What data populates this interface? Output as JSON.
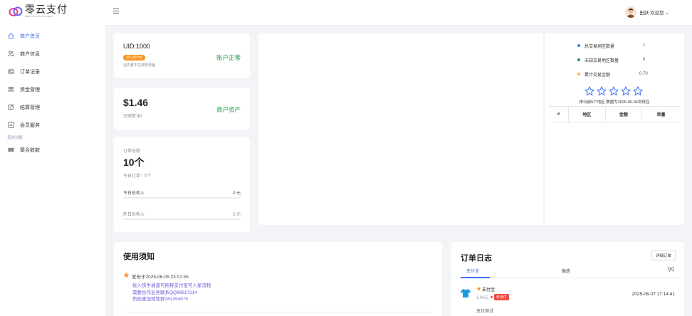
{
  "brand": {
    "title": "零云支付",
    "subtitle": "ZERO CLOUD PAYMENT"
  },
  "sidebar": {
    "items": [
      {
        "label": "商户首页",
        "icon": "home-icon",
        "active": true
      },
      {
        "label": "商户信息",
        "icon": "users-icon"
      },
      {
        "label": "订单记录",
        "icon": "order-icon"
      },
      {
        "label": "资金管理",
        "icon": "funds-icon"
      },
      {
        "label": "结算管理",
        "icon": "settle-icon"
      },
      {
        "label": "会员服务",
        "icon": "member-icon"
      }
    ],
    "section_label": "其他功能",
    "extra_items": [
      {
        "label": "聚合收款",
        "icon": "barcode-icon"
      }
    ]
  },
  "topbar": {
    "user_text": "田跃 欢迎您 ⌄"
  },
  "account": {
    "uid": "UID:1000",
    "badge": "新认用户组",
    "hint": "当内置不失效的界面",
    "status": "账户正常"
  },
  "assets": {
    "amount": "$1.46",
    "settled": "已结算:$0",
    "label": "商户资产"
  },
  "orders_summary": {
    "label": "订单总数",
    "count": "10个",
    "today": "今日订单：0个",
    "today_income_label": "今日总收入",
    "today_income_value": "0 元",
    "yesterday_income_label": "昨日总收入",
    "yesterday_income_value": "0 元"
  },
  "region_stats": {
    "rows": [
      {
        "label": "总交易地区数量",
        "value": "1",
        "color": "#3b82f6"
      },
      {
        "label": "未知交易地区数量",
        "value": "0",
        "color": "#1aa14a"
      },
      {
        "label": "累计交易金额",
        "value": "0.70",
        "color": "#f7b731"
      }
    ],
    "stars": 5,
    "caption": "排行前5个地区 数据为2025-06-04到现在",
    "columns": [
      "#",
      "地区",
      "金额",
      "单量"
    ]
  },
  "notice": {
    "title": "使用须知",
    "posted": "发布于2025-06-05 23:01:55",
    "lines": [
      "接入快手通道可拖移支付宝可入星流程",
      "需要合作业务联系QQ99817214",
      "伤检查加地管群281354575"
    ]
  },
  "order_log": {
    "title": "订单日志",
    "detail_button": "详细订单",
    "tabs": [
      "支付宝",
      "微信",
      "QQ"
    ],
    "entry": {
      "method": "支付宝",
      "amount": "1.00元",
      "status": "未支付",
      "time": "2025-06-07 17:14:41",
      "desc": "支付测试"
    }
  },
  "colors": {
    "accent": "#3b6ef5",
    "green": "#1aa14a",
    "orange": "#f7941e",
    "red": "#f0483e"
  }
}
